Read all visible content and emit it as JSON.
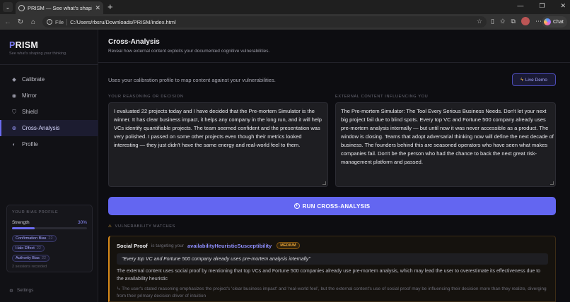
{
  "browser": {
    "tab_title": "PRISM — See what's shaping your thinking",
    "url_scheme": "File",
    "url": "C:/Users/rbsru/Downloads/PRISM/index.html",
    "copilot_label": "Chat"
  },
  "brand": {
    "name_rest": "RISM",
    "name_first": "P",
    "tagline": "See what's shaping your thinking.",
    "accent": "#6b6bf0"
  },
  "nav": {
    "items": [
      {
        "label": "Calibrate",
        "icon": "diamond-icon"
      },
      {
        "label": "Mirror",
        "icon": "circle-icon"
      },
      {
        "label": "Shield",
        "icon": "shield-icon"
      },
      {
        "label": "Cross-Analysis",
        "icon": "crosshair-icon"
      },
      {
        "label": "Profile",
        "icon": "half-circle-icon"
      }
    ],
    "active": "Cross-Analysis"
  },
  "bias_profile": {
    "title": "YOUR BIAS PROFILE",
    "strength_label": "Strength",
    "strength_pct": "30%",
    "strength_value": 0.3,
    "chips": [
      {
        "label": "Confirmation Bias",
        "count": "22"
      },
      {
        "label": "Halo Effect",
        "count": "22"
      },
      {
        "label": "Authority Bias",
        "count": "22"
      }
    ],
    "sessions": "2 sessions recorded"
  },
  "settings_label": "Settings",
  "page": {
    "title": "Cross-Analysis",
    "subtitle": "Reveal how external content exploits your documented cognitive vulnerabilities.",
    "intro": "Uses your calibration profile to map content against your vulnerabilities.",
    "live_demo": "Live Demo"
  },
  "reasoning": {
    "label": "YOUR REASONING OR DECISION",
    "value": "I evaluated 22 projects today and I have decided that the Pre-mortem Simulator is the winner. It has clear business impact, it helps any company in the long run, and it will help VCs identify quantifiable projects. The team seemed confident and the presentation was very polished. I passed on some other projects even though their metrics looked interesting — they just didn't have the same energy and real-world feel to them."
  },
  "external": {
    "label": "EXTERNAL CONTENT INFLUENCING YOU",
    "value": "The Pre-mortem Simulator: The Tool Every Serious Business Needs. Don't let your next big project fail due to blind spots. Every top VC and Fortune 500 company already uses pre-mortem analysis internally — but until now it was never accessible as a product. The window is closing. Teams that adopt adversarial thinking now will define the next decade of business. The founders behind this are seasoned operators who have seen what makes companies fail. Don't be the person who had the chance to back the next great risk-management platform and passed."
  },
  "run_button": "RUN CROSS-ANALYSIS",
  "matches_label": "VULNERABILITY MATCHES",
  "match": {
    "bias": "Social Proof",
    "targeting": "is targeting your",
    "vulnerability": "availabilityHeuristicSusceptibility",
    "severity": "MEDIUM",
    "quote": "\"Every top VC and Fortune 500 company already uses pre-mortem analysis internally\"",
    "explanation": "The external content uses social proof by mentioning that top VCs and Fortune 500 companies already use pre-mortem analysis, which may lead the user to overestimate its effectiveness due to the availability heuristic",
    "note": "↳ The user's stated reasoning emphasizes the project's 'clear business impact' and 'real-world feel', but the external content's use of social proof may be influencing their decision more than they realize, diverging from their primary decision driver of intuition"
  }
}
